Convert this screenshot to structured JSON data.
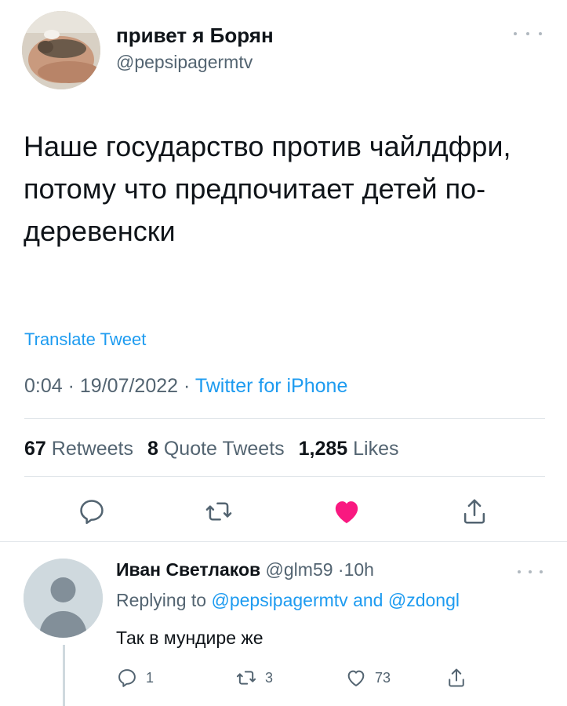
{
  "tweet": {
    "author_name": "привет я Борян",
    "author_handle": "@pepsipagermtv",
    "text": "Наше государство против чайлдфри, потому что предпочитает детей по-деревенски",
    "translate_label": "Translate Tweet",
    "time": "0:04",
    "date": "19/07/2022",
    "source": "Twitter for iPhone",
    "separator": "·",
    "stats": {
      "retweets_count": "67",
      "retweets_label": "Retweets",
      "quotes_count": "8",
      "quotes_label": "Quote Tweets",
      "likes_count": "1,285",
      "likes_label": "Likes"
    },
    "liked": true,
    "like_color": "#f91880"
  },
  "reply": {
    "author_name": "Иван Светлаков",
    "author_handle": "@glm59",
    "age": "10h",
    "replying_prefix": "Replying to",
    "replying_user1": "@pepsipagermtv",
    "replying_and": "and",
    "replying_user2": "@zdongl",
    "text": "Так в мундире же",
    "counts": {
      "replies": "1",
      "retweets": "3",
      "likes": "73"
    }
  },
  "colors": {
    "accent": "#1d9bf0",
    "muted": "#536471",
    "text": "#0f1419"
  }
}
